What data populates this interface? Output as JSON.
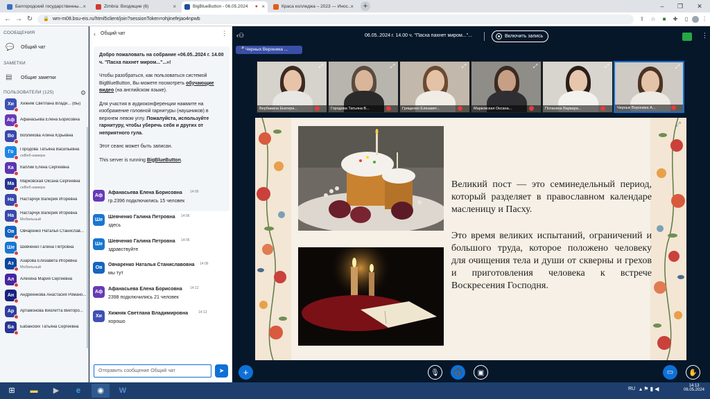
{
  "browser": {
    "tabs": [
      {
        "label": "Белгородский государственны...",
        "active": false
      },
      {
        "label": "Zimbra: Входящие (6)",
        "active": false
      },
      {
        "label": "BigBlueButton - 06.05.2024",
        "active": true
      },
      {
        "label": "Краса колледжа – 2023 — Инос...",
        "active": false
      }
    ],
    "url": "wm-m08.bsu-eis.ru/html5client/join?sessionToken=ohjinefejao4npwb"
  },
  "sidebar": {
    "messages_title": "СООБЩЕНИЯ",
    "public_chat": "Общий чат",
    "notes_title": "ЗАМЕТКИ",
    "shared_notes": "Общие заметки",
    "users_title": "ПОЛЬЗОВАТЕЛИ (125)",
    "users": [
      {
        "initials": "Хи",
        "name": "Хижняк Светлана Влади... (Вы)",
        "sub": "",
        "color": "#3f51b5"
      },
      {
        "initials": "Аф",
        "name": "Афанасьева Елена Борисовна",
        "sub": "",
        "color": "#673ab7"
      },
      {
        "initials": "Во",
        "name": "Вобликова Алина Юрьевна",
        "sub": "",
        "color": "#3949ab"
      },
      {
        "initials": "Го",
        "name": "Городова Татьяна Васильевна",
        "sub": "сеВеб-камера",
        "color": "#1e88e5"
      },
      {
        "initials": "Ка",
        "name": "Каплий Елена Сергеевна",
        "sub": "",
        "color": "#5e35b1"
      },
      {
        "initials": "Ма",
        "name": "Марковская Оксана Сергеевна",
        "sub": "сеВеб-камера",
        "color": "#283593"
      },
      {
        "initials": "На",
        "name": "Настарчук Валерия Игоревна",
        "sub": "",
        "color": "#3949ab"
      },
      {
        "initials": "На",
        "name": "Настарчук Валерия Игоревна",
        "sub": "Мобильный",
        "color": "#3949ab"
      },
      {
        "initials": "Ов",
        "name": "Овчаренко Наталья Станислав...",
        "sub": "",
        "color": "#1565c0"
      },
      {
        "initials": "Ше",
        "name": "Шевченко Галина Петровна",
        "sub": "",
        "color": "#1976d2"
      },
      {
        "initials": "Аз",
        "name": "Азарова Елизавета Игоревна",
        "sub": "Мобильный",
        "color": "#0d47a1"
      },
      {
        "initials": "Ал",
        "name": "Алёхина Мария Сергеевна",
        "sub": "",
        "color": "#4527a0"
      },
      {
        "initials": "Ан",
        "name": "Андреенкова Анастасия Романо...",
        "sub": "",
        "color": "#1a237e"
      },
      {
        "initials": "Ар",
        "name": "Артамонова Виолетта Викторо...",
        "sub": "",
        "color": "#303f9f"
      },
      {
        "initials": "Ба",
        "name": "Бабанских Татьяна Сергеевна",
        "sub": "",
        "color": "#283593"
      }
    ]
  },
  "chat": {
    "title": "Общий чат",
    "welcome": {
      "p1_a": "Добро пожаловать на собрание «06.05..2024 г. 14.00 ч. ",
      "p1_b": "\"Пасха пахнет миром...\"",
      "p1_c": "...»!",
      "p2_a": "Чтобы разобраться, как пользоваться системой BigBlueButton, Вы можете посмотреть ",
      "p2_link": "обучающие видео",
      "p2_b": " (на английском языке).",
      "p3_a": "Для участия в аудиоконференции нажмите на изображение головной гарнитуры (наушников) в верхнем левом углу. ",
      "p3_b": "Пожалуйста, используйте гарнитуру, чтобы уберечь себя и других от неприятного гула.",
      "p4": "Этот сеанс может быть записан.",
      "p5_a": "This server is running ",
      "p5_link": "BigBlueButton",
      "p5_b": "."
    },
    "messages": [
      {
        "initials": "Аф",
        "name": "Афанасьева Елена Борисовна",
        "time": "14:06",
        "text": "гр.2396 подключились 15 человек",
        "color": "#673ab7"
      },
      {
        "initials": "Ше",
        "name": "Шевченко Галина Петровна",
        "time": "14:06",
        "text": "здесь",
        "color": "#1976d2"
      },
      {
        "initials": "Ше",
        "name": "Шевченко Галина Петровна",
        "time": "14:06",
        "text": "здравствуйте",
        "color": "#1976d2"
      },
      {
        "initials": "Ов",
        "name": "Овчаренко Наталья Станиславовна",
        "time": "14:06",
        "text": "мы тут",
        "color": "#1565c0"
      },
      {
        "initials": "Аф",
        "name": "Афанасьева Елена Борисовна",
        "time": "14:12",
        "text": "2398 подключились 21 человек",
        "color": "#673ab7"
      },
      {
        "initials": "Хи",
        "name": "Хижняк Светлана Владимировна",
        "time": "14:12",
        "text": "хорошо",
        "color": "#3f51b5"
      }
    ],
    "input_placeholder": "Отправить сообщение Общий чат"
  },
  "meeting": {
    "title": "06.05..2024 г. 14.00 ч. \"Пасха пахнет миром...\"...",
    "record_label": "Включить запись",
    "talking": "Черных Вероника ..."
  },
  "videos": [
    {
      "name": "Вербавина Екатери...",
      "bg": "#d6d2cc",
      "skin": "#e7c4a8",
      "hair": "#3b2a22",
      "shirt": "#e8e6e2"
    },
    {
      "name": "Городова Татьяна В...",
      "bg": "#b8b5ae",
      "skin": "#d9b59a",
      "hair": "#5a4a3f",
      "shirt": "#2a2a2a"
    },
    {
      "name": "Грищенко Елизавет...",
      "bg": "#c2b8ab",
      "skin": "#e3c2a6",
      "hair": "#6b4a32",
      "shirt": "#f0ece6"
    },
    {
      "name": "Марковская Оксана...",
      "bg": "#8f8d88",
      "skin": "#c79f85",
      "hair": "#3a2a22",
      "shirt": "#2f2f33"
    },
    {
      "name": "Потанина Варвара...",
      "bg": "#d8d4ce",
      "skin": "#e6c7ae",
      "hair": "#2b1e18",
      "shirt": "#f4f2ee"
    },
    {
      "name": "Черных Вероника А...",
      "bg": "#cfcac3",
      "skin": "#e5c3a8",
      "hair": "#4a3324",
      "shirt": "#eeeae4"
    }
  ],
  "slide": {
    "p1": "Великий пост — это семинедельный период, который разделяет в православном календаре масленицу и Пасху.",
    "p2": "Это время великих испытаний, ограничений и большого труда, которое положено человеку для очищения тела и души от скверны и грехов и приготовления человека к встрече Воскресения Господня."
  },
  "taskbar": {
    "lang": "RU",
    "time": "14:13",
    "date": "06.05.2024"
  },
  "colors": {
    "accent": "#0f70d7",
    "app_bg": "#06172a",
    "talking": "#3a4fa8"
  }
}
